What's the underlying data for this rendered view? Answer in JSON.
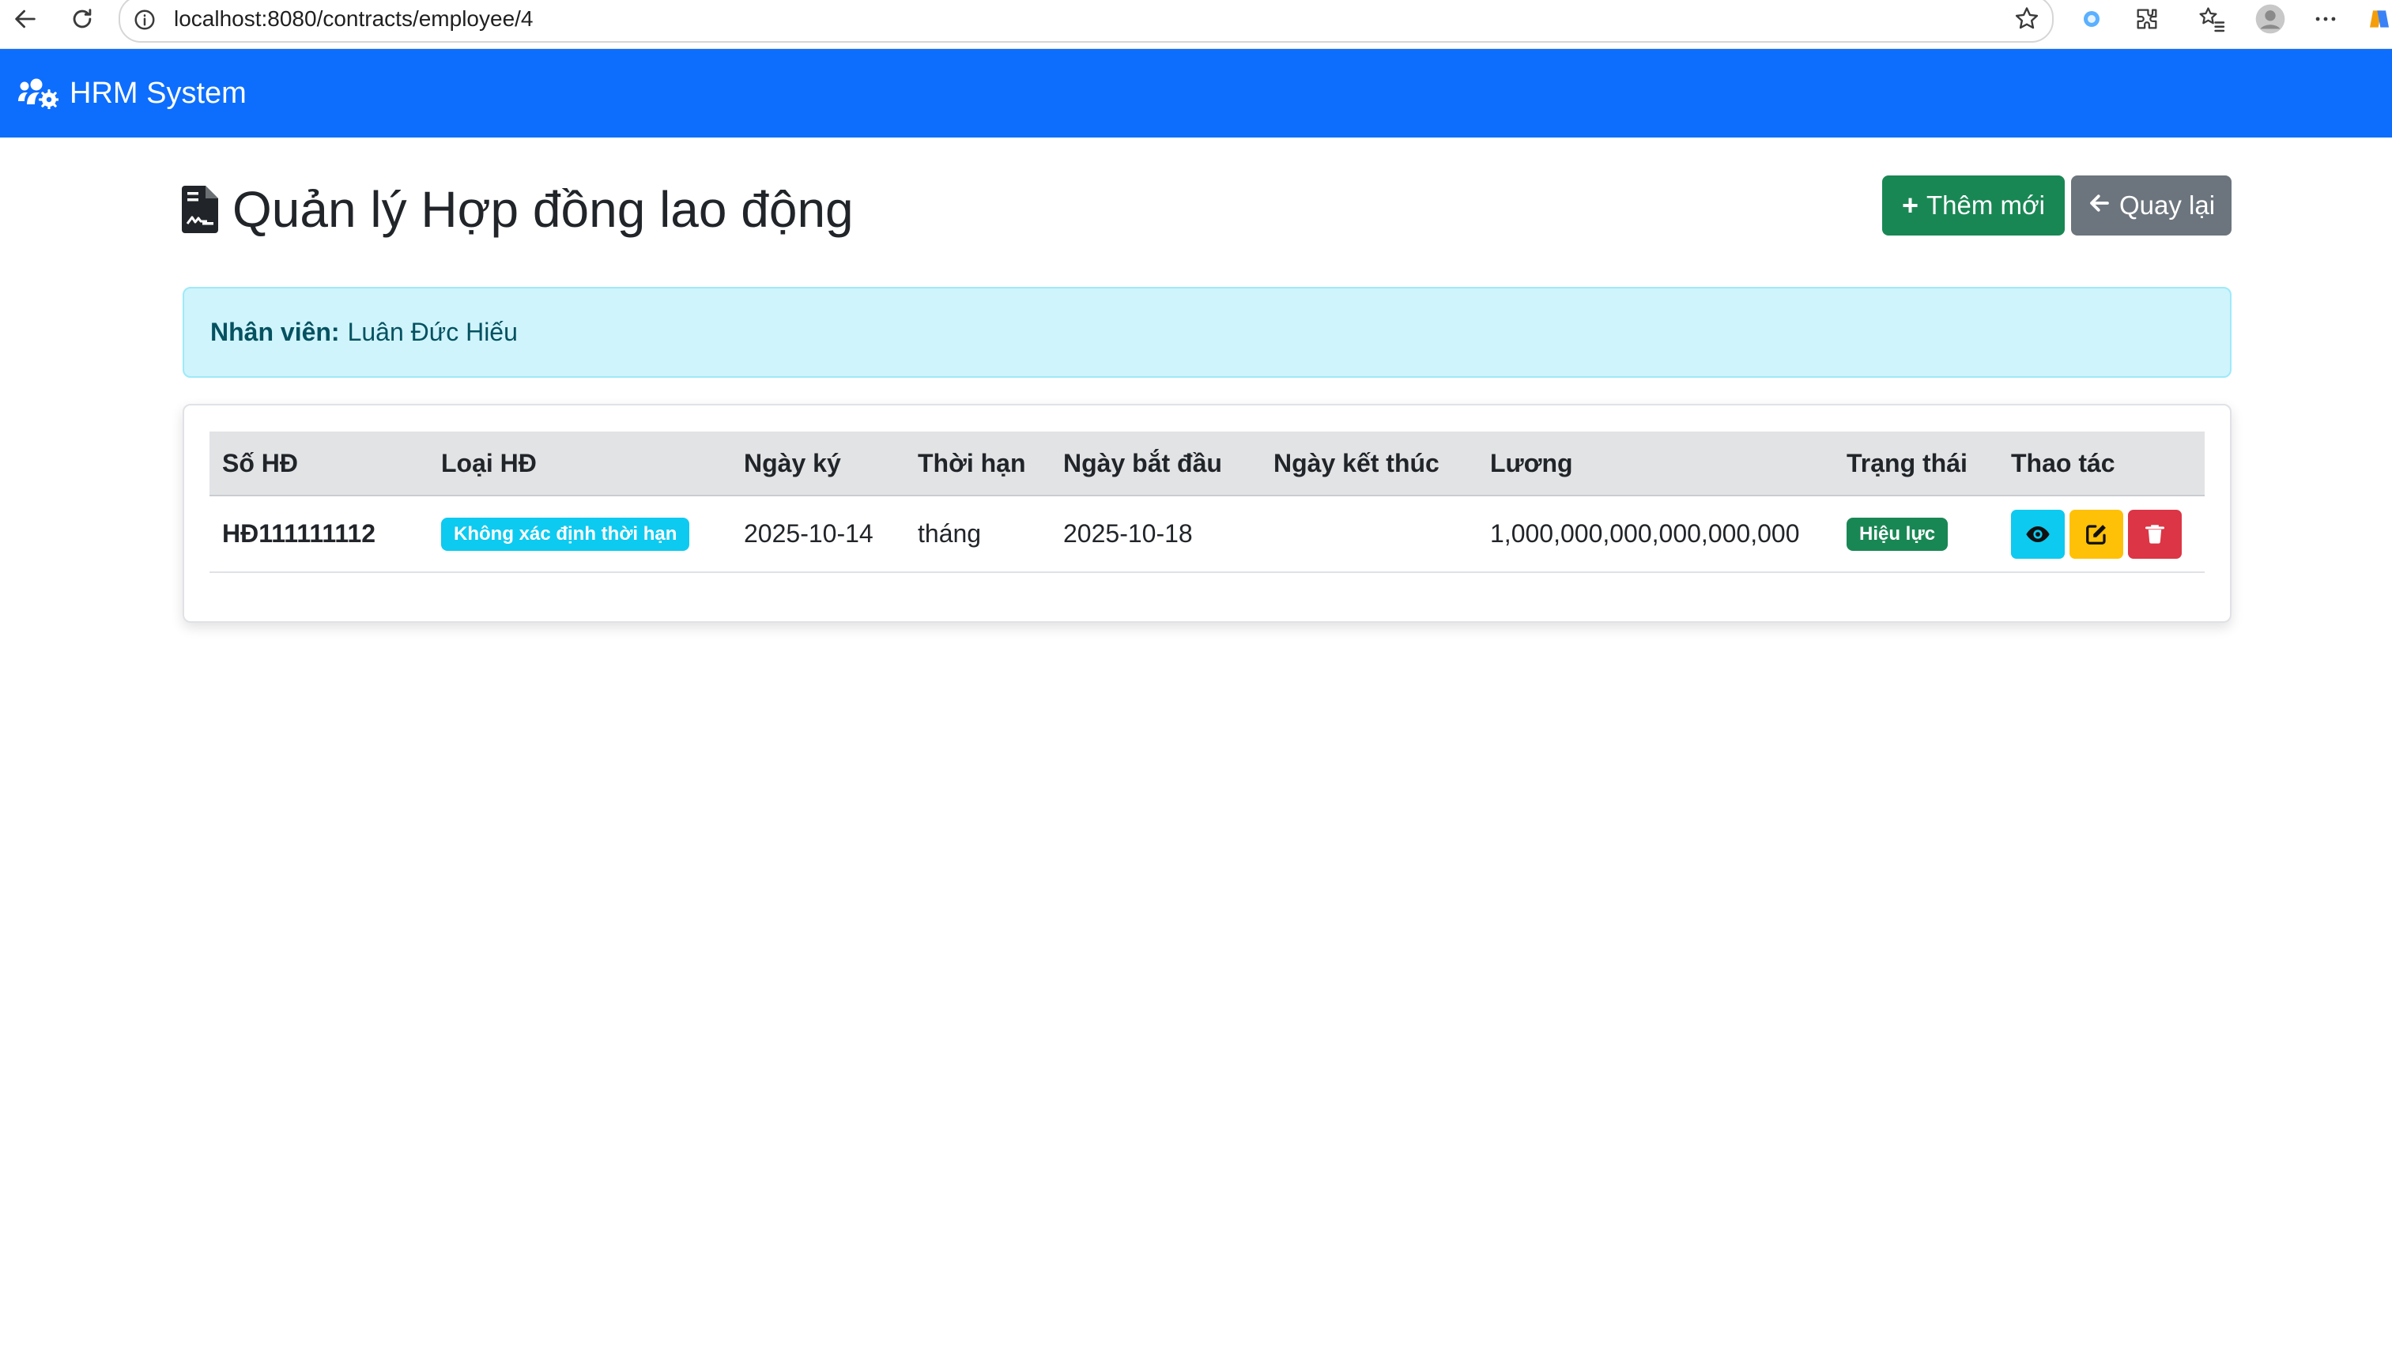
{
  "browser": {
    "url": "localhost:8080/contracts/employee/4"
  },
  "navbar": {
    "brand": "HRM System"
  },
  "header": {
    "title": "Quản lý Hợp đồng lao động",
    "add_button": "Thêm mới",
    "back_button": "Quay lại"
  },
  "employee_alert": {
    "label": "Nhân viên:",
    "name": "Luân Đức Hiếu"
  },
  "table": {
    "columns": [
      "Số HĐ",
      "Loại HĐ",
      "Ngày ký",
      "Thời hạn",
      "Ngày bắt đầu",
      "Ngày kết thúc",
      "Lương",
      "Trạng thái",
      "Thao tác"
    ],
    "rows": [
      {
        "so_hd": "HĐ111111112",
        "loai_hd": "Không xác định thời hạn",
        "ngay_ky": "2025-10-14",
        "thoi_han": "tháng",
        "ngay_bat_dau": "2025-10-18",
        "ngay_ket_thuc": "",
        "luong": "1,000,000,000,000,000,000",
        "trang_thai": "Hiệu lực"
      }
    ]
  },
  "colors": {
    "primary": "#0d6efd",
    "success": "#198754",
    "secondary": "#6c757d",
    "info": "#0dcaf0",
    "warning": "#ffc107",
    "danger": "#dc3545"
  },
  "icons": [
    "back-arrow-icon",
    "reload-icon",
    "info-icon",
    "star-icon",
    "extension-icon",
    "favorites-icon",
    "profile-icon",
    "more-icon",
    "users-cog-icon",
    "file-contract-icon",
    "plus-icon",
    "arrow-left-icon",
    "eye-icon",
    "edit-icon",
    "trash-icon"
  ]
}
